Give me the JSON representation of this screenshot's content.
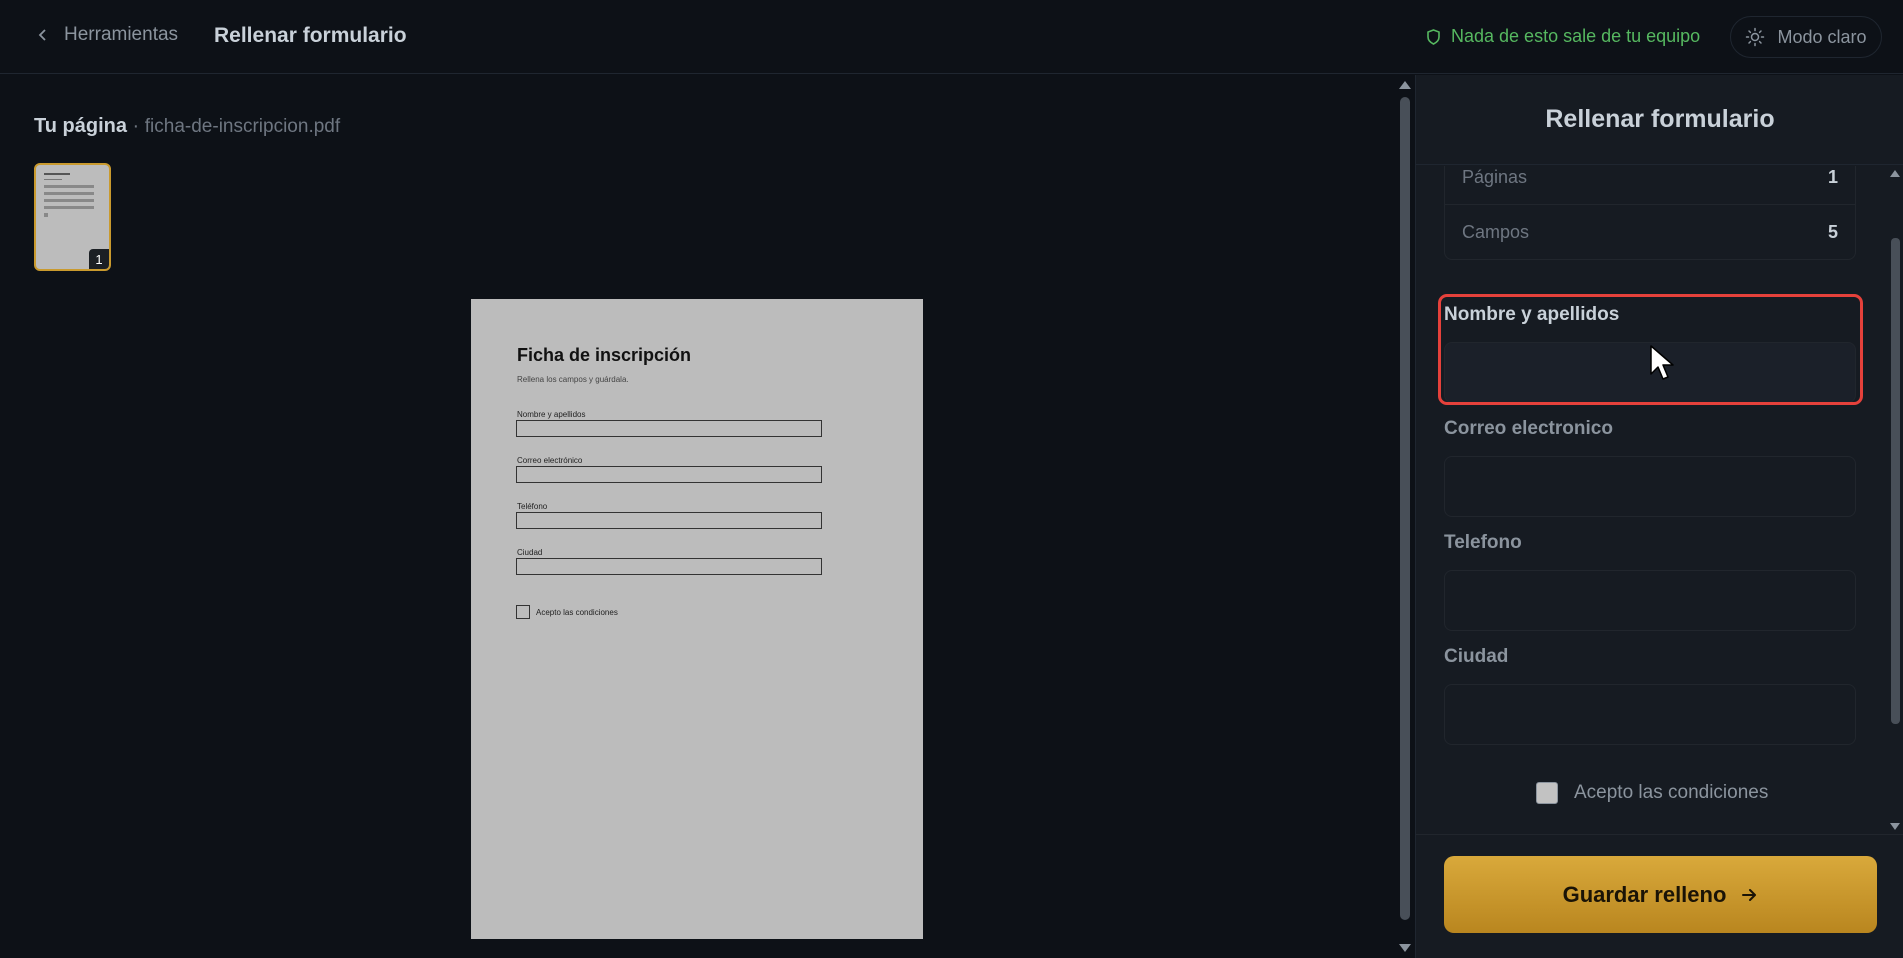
{
  "header": {
    "back_label": "Herramientas",
    "title": "Rellenar formulario",
    "privacy_note": "Nada de esto sale de tu equipo",
    "mode_toggle_label": "Modo claro"
  },
  "preview": {
    "heading": "Tu página",
    "separator": "·",
    "file_name": "ficha-de-inscripcion.pdf",
    "thumbnail_page_number": "1",
    "document": {
      "title": "Ficha de inscripción",
      "subtitle": "Rellena los campos y guárdala.",
      "fields": [
        "Nombre y apellidos",
        "Correo electrónico",
        "Teléfono",
        "Ciudad"
      ],
      "checkbox_label": "Acepto las condiciones"
    }
  },
  "panel": {
    "title": "Rellenar formulario",
    "stats": [
      {
        "label": "Páginas",
        "value": "1"
      },
      {
        "label": "Campos",
        "value": "5"
      }
    ],
    "fields": [
      {
        "label": "Nombre y apellidos",
        "value": ""
      },
      {
        "label": "Correo electronico",
        "value": ""
      },
      {
        "label": "Telefono",
        "value": ""
      },
      {
        "label": "Ciudad",
        "value": ""
      }
    ],
    "checkbox_label": "Acepto las condiciones",
    "save_label": "Guardar relleno"
  },
  "colors": {
    "background": "#0d1117",
    "panel": "#161b22",
    "accent": "#c99a2e",
    "privacy_green": "#56b860",
    "focus_red": "#e5413b"
  }
}
